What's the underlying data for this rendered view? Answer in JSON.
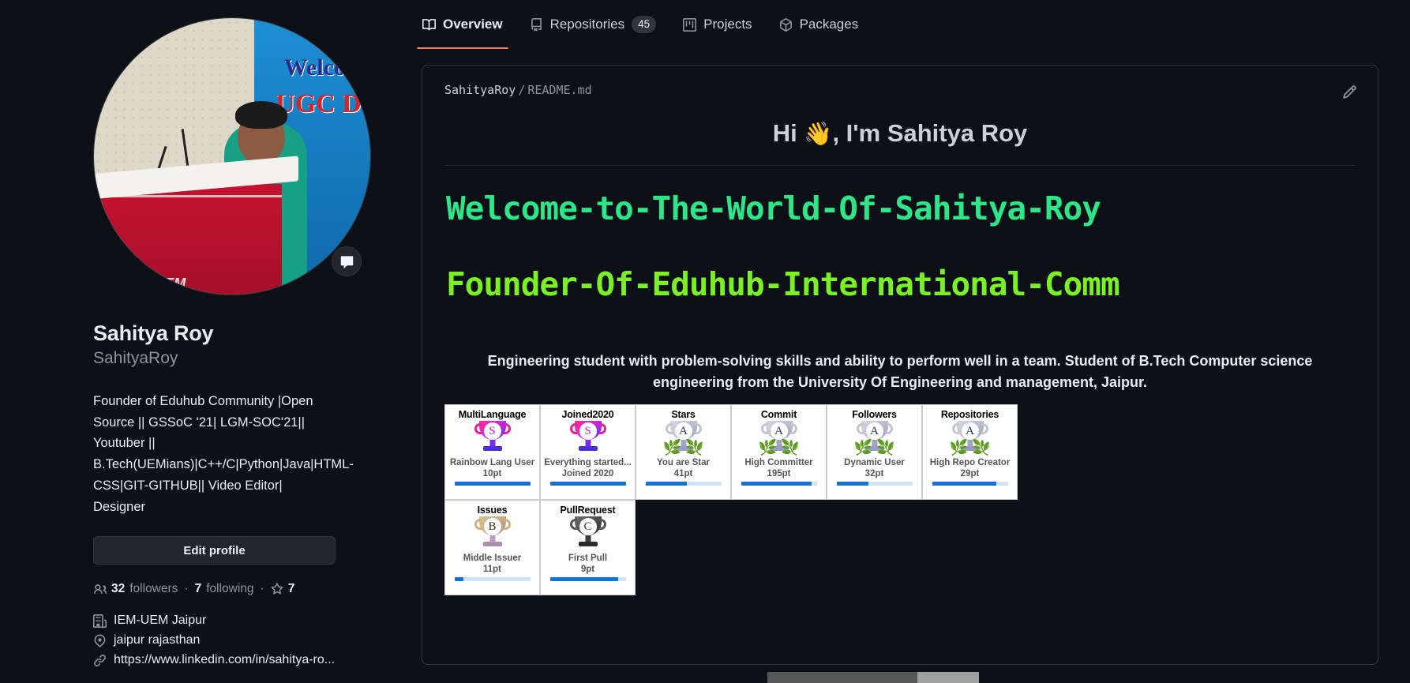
{
  "tabs": [
    {
      "label": "Overview",
      "icon": "book-icon",
      "active": true,
      "count": null
    },
    {
      "label": "Repositories",
      "icon": "repo-icon",
      "active": false,
      "count": "45"
    },
    {
      "label": "Projects",
      "icon": "project-icon",
      "active": false,
      "count": null
    },
    {
      "label": "Packages",
      "icon": "package-icon",
      "active": false,
      "count": null
    }
  ],
  "profile": {
    "name": "Sahitya Roy",
    "login": "SahityaRoy",
    "bio": "Founder of Eduhub Community |Open Source || GSSoC '21| LGM-SOC'21|| Youtuber || B.Tech(UEMians)|C++/C|Python|Java|HTML-CSS|GIT-GITHUB|| Video Editor| Designer",
    "edit_label": "Edit profile",
    "followers_count": "32",
    "followers_label": "followers",
    "following_count": "7",
    "following_label": "following",
    "stars_count": "7",
    "organization": "IEM-UEM Jaipur",
    "location": "jaipur rajasthan",
    "link": "https://www.linkedin.com/in/sahitya-ro..."
  },
  "readme": {
    "crumb_user": "SahityaRoy",
    "crumb_file": "README.md",
    "heading_prefix": "Hi ",
    "heading_wave": "👋",
    "heading_suffix": ", I'm Sahitya Roy",
    "typing_line1": "Welcome-to-The-World-Of-Sahitya-Roy",
    "typing_line2": "Founder-Of-Eduhub-International-Comm",
    "description": "Engineering student with problem-solving skills and ability to perform well in a team. Student of B.Tech Computer science engineering from the University Of Engineering and management, Jaipur.",
    "typing_color1": "#2ee68a",
    "typing_color2": "#7bf024"
  },
  "trophies": [
    {
      "title": "MultiLanguage",
      "rank": "S",
      "desc": "Rainbow Lang User",
      "points": "10pt",
      "progress": 100,
      "style": "rainbow",
      "laurel": false
    },
    {
      "title": "Joined2020",
      "rank": "S",
      "desc": "Everything started...",
      "points": "Joined 2020",
      "progress": 100,
      "style": "rainbow",
      "laurel": false
    },
    {
      "title": "Stars",
      "rank": "A",
      "desc": "You are Star",
      "points": "41pt",
      "progress": 55,
      "style": "silver",
      "laurel": true
    },
    {
      "title": "Commit",
      "rank": "A",
      "desc": "High Committer",
      "points": "195pt",
      "progress": 93,
      "style": "silver",
      "laurel": true
    },
    {
      "title": "Followers",
      "rank": "A",
      "desc": "Dynamic User",
      "points": "32pt",
      "progress": 42,
      "style": "silver",
      "laurel": true
    },
    {
      "title": "Repositories",
      "rank": "A",
      "desc": "High Repo Creator",
      "points": "29pt",
      "progress": 85,
      "style": "silver",
      "laurel": true
    },
    {
      "title": "Issues",
      "rank": "B",
      "desc": "Middle Issuer",
      "points": "11pt",
      "progress": 12,
      "style": "bronze",
      "laurel": false
    },
    {
      "title": "PullRequest",
      "rank": "C",
      "desc": "First Pull",
      "points": "9pt",
      "progress": 90,
      "style": "dark",
      "laurel": false
    }
  ],
  "colors": {
    "background": "#0d1117",
    "border": "#30363d",
    "text": "#e6edf3",
    "muted": "#8b949e",
    "accent": "#f78166",
    "progress": "#1273d4"
  }
}
